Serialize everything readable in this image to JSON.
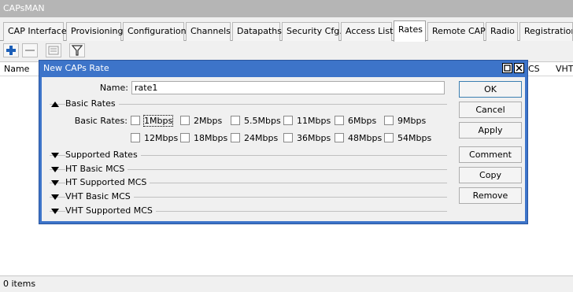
{
  "window_title": "CAPsMAN",
  "tabs": [
    {
      "label": "CAP Interface"
    },
    {
      "label": "Provisioning"
    },
    {
      "label": "Configurations"
    },
    {
      "label": "Channels"
    },
    {
      "label": "Datapaths"
    },
    {
      "label": "Security Cfg."
    },
    {
      "label": "Access List"
    },
    {
      "label": "Rates"
    },
    {
      "label": "Remote CAP"
    },
    {
      "label": "Radio"
    },
    {
      "label": "Registration T"
    }
  ],
  "active_tab": "Rates",
  "toolbar": {
    "icons": [
      "plus-icon",
      "minus-icon",
      "comment-icon",
      "filter-icon"
    ]
  },
  "grid": {
    "columns": [
      "Name",
      "CS",
      "VHT"
    ]
  },
  "status": {
    "items_text": "0 items"
  },
  "dialog": {
    "title": "New CAPs Rate",
    "name_label": "Name:",
    "name_value": "rate1",
    "sections": {
      "basic_rates": "Basic Rates",
      "supported_rates": "Supported Rates",
      "ht_basic_mcs": "HT Basic MCS",
      "ht_supported_mcs": "HT Supported MCS",
      "vht_basic_mcs": "VHT Basic MCS",
      "vht_supported_mcs": "VHT Supported MCS"
    },
    "basic_rates_label": "Basic Rates:",
    "rates": [
      "1Mbps",
      "2Mbps",
      "5.5Mbps",
      "11Mbps",
      "6Mbps",
      "9Mbps",
      "12Mbps",
      "18Mbps",
      "24Mbps",
      "36Mbps",
      "48Mbps",
      "54Mbps"
    ],
    "buttons": {
      "ok": "OK",
      "cancel": "Cancel",
      "apply": "Apply",
      "comment": "Comment",
      "copy": "Copy",
      "remove": "Remove"
    }
  },
  "colors": {
    "dialog_frame": "#3d74c9",
    "plus_icon": "#1d5fb8"
  }
}
